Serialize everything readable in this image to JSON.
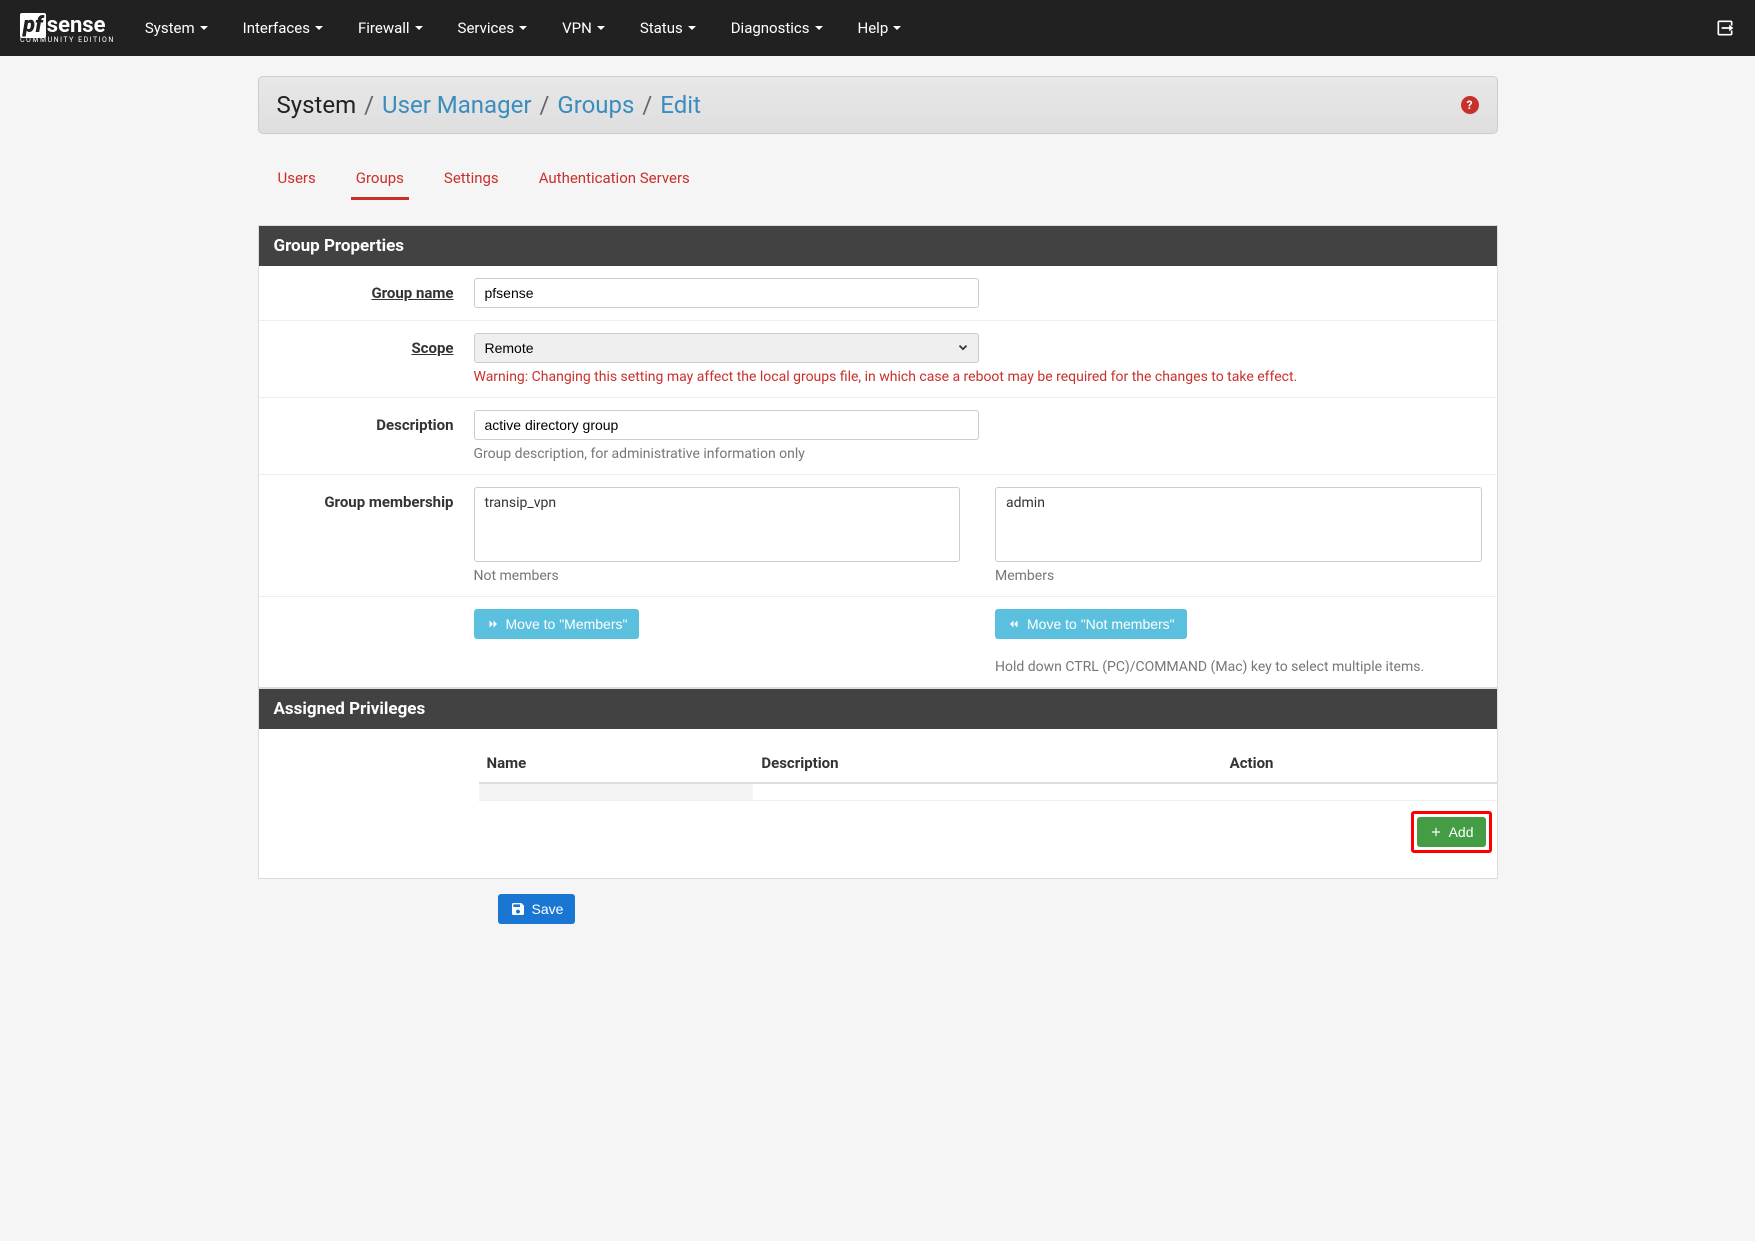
{
  "logo": {
    "boxed": "pf",
    "rest": "sense",
    "sub": "COMMUNITY EDITION"
  },
  "nav": [
    {
      "label": "System",
      "has_caret": true
    },
    {
      "label": "Interfaces",
      "has_caret": true
    },
    {
      "label": "Firewall",
      "has_caret": true
    },
    {
      "label": "Services",
      "has_caret": true
    },
    {
      "label": "VPN",
      "has_caret": true
    },
    {
      "label": "Status",
      "has_caret": true
    },
    {
      "label": "Diagnostics",
      "has_caret": true
    },
    {
      "label": "Help",
      "has_caret": true
    }
  ],
  "breadcrumb": {
    "root": "System",
    "parts": [
      "User Manager",
      "Groups",
      "Edit"
    ]
  },
  "tabs": [
    {
      "label": "Users",
      "active": false
    },
    {
      "label": "Groups",
      "active": true
    },
    {
      "label": "Settings",
      "active": false
    },
    {
      "label": "Authentication Servers",
      "active": false
    }
  ],
  "panels": {
    "group_properties": {
      "title": "Group Properties",
      "fields": {
        "group_name": {
          "label": "Group name",
          "value": "pfsense"
        },
        "scope": {
          "label": "Scope",
          "value": "Remote",
          "warning": "Warning: Changing this setting may affect the local groups file, in which case a reboot may be required for the changes to take effect."
        },
        "description": {
          "label": "Description",
          "value": "active directory group",
          "help": "Group description, for administrative information only"
        },
        "membership": {
          "label": "Group membership",
          "not_members": [
            "transip_vpn"
          ],
          "members": [
            "admin"
          ],
          "not_members_label": "Not members",
          "members_label": "Members",
          "move_to_members_btn": "Move to \"Members\"",
          "move_to_not_members_btn": "Move to \"Not members\"",
          "help": "Hold down CTRL (PC)/COMMAND (Mac) key to select multiple items."
        }
      }
    },
    "assigned_privileges": {
      "title": "Assigned Privileges",
      "columns": [
        "Name",
        "Description",
        "Action"
      ],
      "rows": [],
      "add_btn": "Add"
    }
  },
  "save_btn": "Save",
  "help_icon": "?"
}
